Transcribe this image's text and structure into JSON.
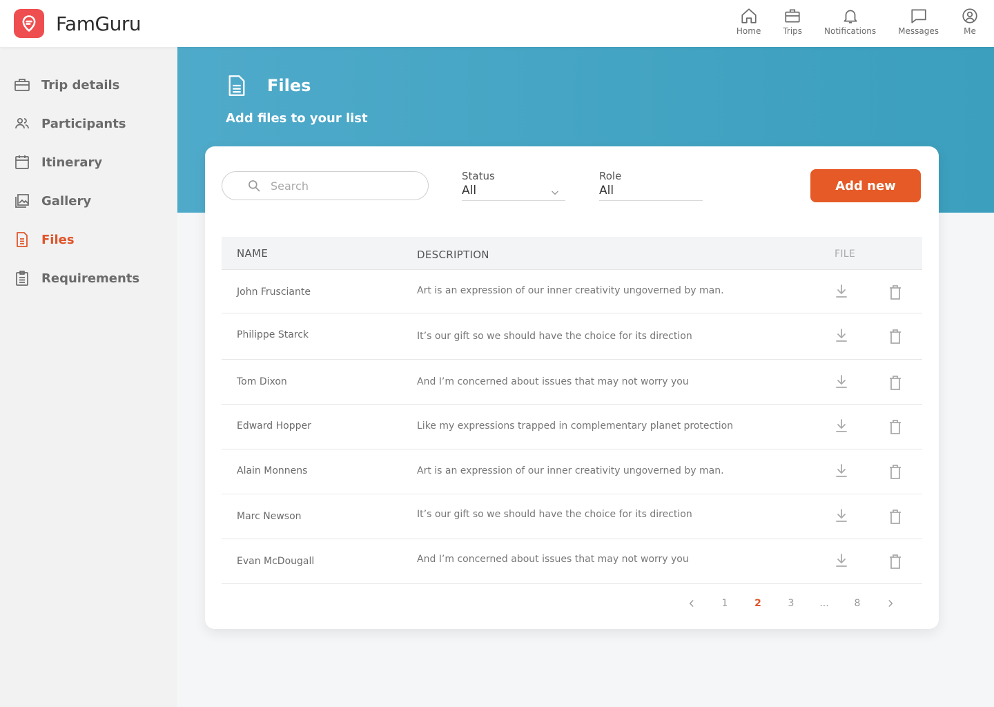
{
  "app": {
    "name": "FamGuru"
  },
  "nav": [
    {
      "label": "Home",
      "icon": "home-icon"
    },
    {
      "label": "Trips",
      "icon": "briefcase-icon"
    },
    {
      "label": "Notifications",
      "icon": "bell-icon"
    },
    {
      "label": "Messages",
      "icon": "message-icon"
    },
    {
      "label": "Me",
      "icon": "user-circle-icon"
    }
  ],
  "sidebar": {
    "items": [
      {
        "label": "Trip details",
        "icon": "briefcase-icon",
        "active": false
      },
      {
        "label": "Participants",
        "icon": "people-icon",
        "active": false
      },
      {
        "label": "Itinerary",
        "icon": "calendar-icon",
        "active": false
      },
      {
        "label": "Gallery",
        "icon": "gallery-icon",
        "active": false
      },
      {
        "label": "Files",
        "icon": "file-icon",
        "active": true
      },
      {
        "label": "Requirements",
        "icon": "clipboard-icon",
        "active": false
      }
    ]
  },
  "hero": {
    "title": "Files",
    "subtitle": "Add files to your list"
  },
  "toolbar": {
    "search_placeholder": "Search",
    "status_label": "Status",
    "status_value": "All",
    "role_label": "Role",
    "role_value": "All",
    "add_label": "Add new"
  },
  "table": {
    "headers": {
      "name": "NAME",
      "description": "DESCRIPTION",
      "file": "FILE"
    },
    "rows": [
      {
        "name": "John Frusciante",
        "description": "Art is an expression of our inner creativity ungoverned by man."
      },
      {
        "name": "Philippe Starck",
        "description": "It’s our gift so we should have the choice for its direction"
      },
      {
        "name": "Tom Dixon",
        "description": "And I’m concerned about issues that may not worry you"
      },
      {
        "name": "Edward Hopper",
        "description": "Like my expressions trapped in complementary planet protection"
      },
      {
        "name": "Alain Monnens",
        "description": "Art is an expression of our inner creativity ungoverned by man."
      },
      {
        "name": "Marc Newson",
        "description": "It’s our gift so we should have the choice for its direction"
      },
      {
        "name": "Evan McDougall",
        "description": "And I’m concerned about issues that may not worry you"
      }
    ]
  },
  "pagination": {
    "pages": [
      "1",
      "2",
      "3",
      "...",
      "8"
    ],
    "current": "2"
  },
  "colors": {
    "accent": "#e55a26",
    "hero": "#45a6c5",
    "brand": "#ee4e4f"
  }
}
